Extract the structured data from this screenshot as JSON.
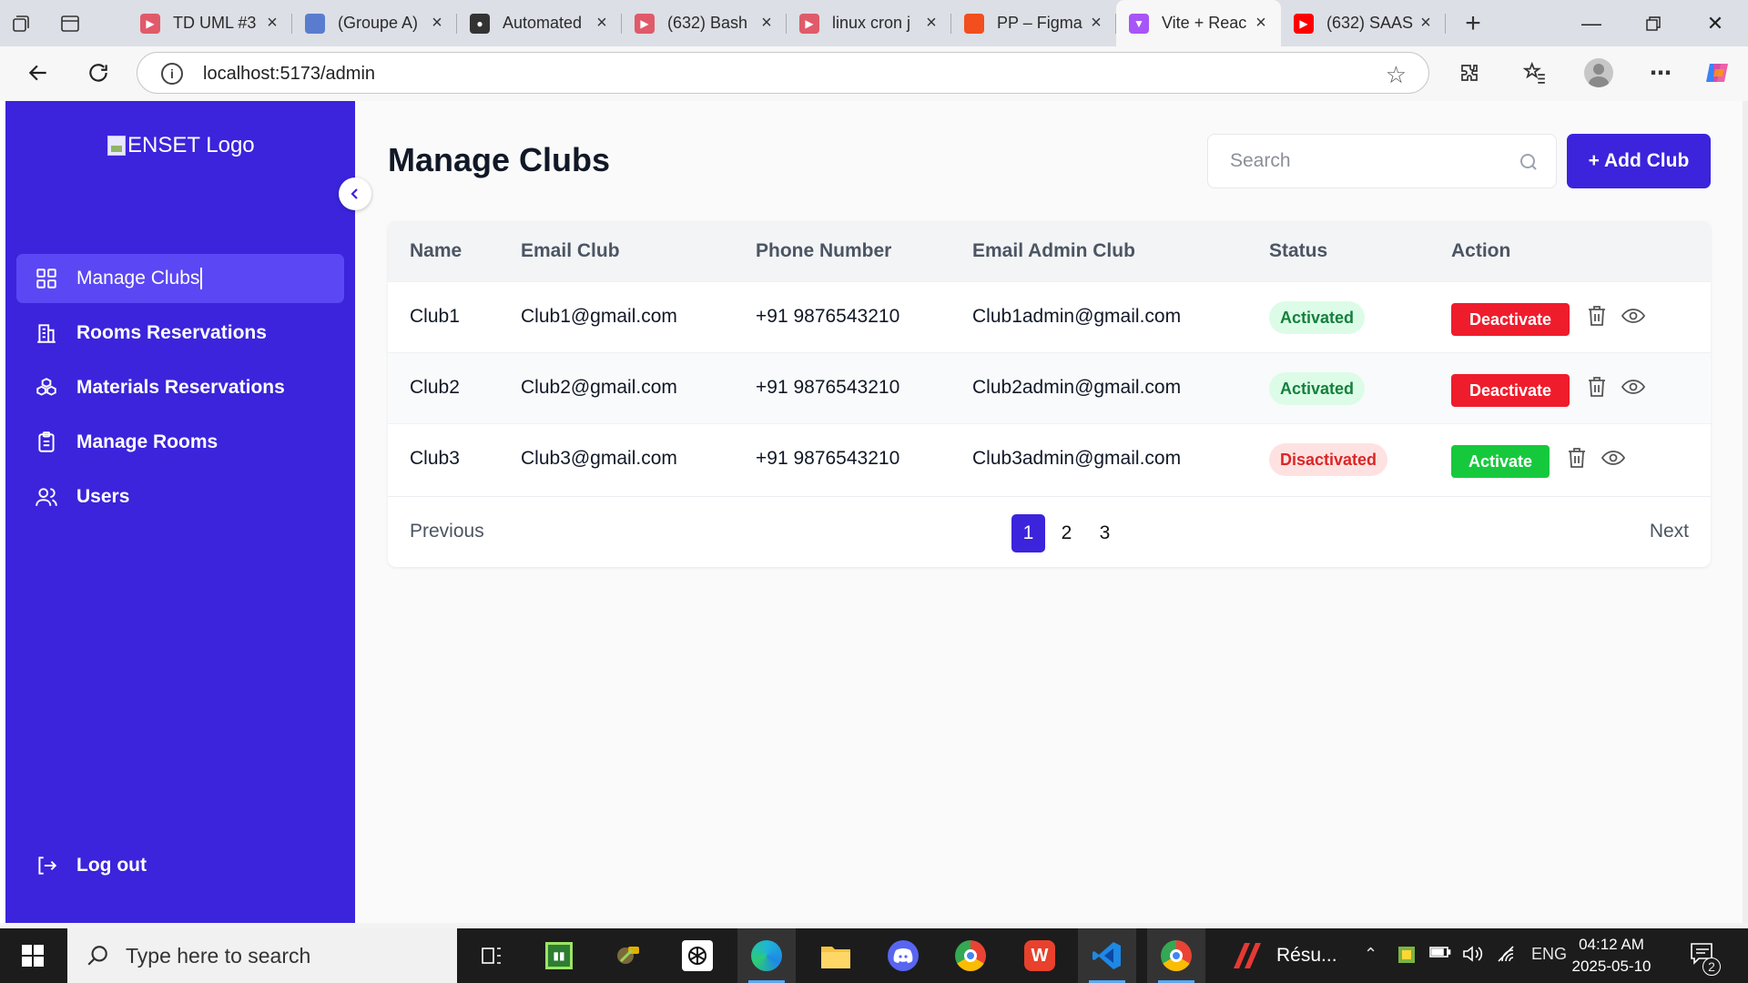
{
  "browser": {
    "tabs": [
      {
        "title": "TD UML #3",
        "favicon": "youtube-icon",
        "color": "#e05a6a"
      },
      {
        "title": "(Groupe A)",
        "favicon": "contacts-icon",
        "color": "#5a7ccf"
      },
      {
        "title": "Automated",
        "favicon": "github-icon",
        "color": "#333333"
      },
      {
        "title": "(632) Bash",
        "favicon": "youtube-icon",
        "color": "#e05a6a"
      },
      {
        "title": "linux cron j",
        "favicon": "youtube-icon",
        "color": "#e05a6a"
      },
      {
        "title": "PP – Figma",
        "favicon": "figma-icon",
        "color": "#f24e1e"
      },
      {
        "title": "Vite + Reac",
        "favicon": "vite-icon",
        "color": "#a855f7",
        "active": true
      },
      {
        "title": "(632) SAAS",
        "favicon": "youtube-icon",
        "color": "#ff0000"
      }
    ],
    "url": "localhost:5173/admin"
  },
  "sidebar": {
    "logo_alt": "ENSET Logo",
    "items": [
      {
        "label": "Manage Clubs",
        "icon": "grid-icon",
        "active": true
      },
      {
        "label": "Rooms Reservations",
        "icon": "building-icon"
      },
      {
        "label": "Materials Reservations",
        "icon": "boxes-icon"
      },
      {
        "label": "Manage Rooms",
        "icon": "clipboard-icon"
      },
      {
        "label": "Users",
        "icon": "users-icon"
      }
    ],
    "logout_label": "Log out"
  },
  "main": {
    "title": "Manage Clubs",
    "search_placeholder": "Search",
    "add_button": "+ Add Club",
    "columns": [
      "Name",
      "Email Club",
      "Phone Number",
      "Email Admin Club",
      "Status",
      "Action"
    ],
    "rows": [
      {
        "name": "Club1",
        "email": "Club1@gmail.com",
        "phone": "+91 9876543210",
        "admin_email": "Club1admin@gmail.com",
        "status": "Activated",
        "action": "Deactivate"
      },
      {
        "name": "Club2",
        "email": "Club2@gmail.com",
        "phone": "+91 9876543210",
        "admin_email": "Club2admin@gmail.com",
        "status": "Activated",
        "action": "Deactivate"
      },
      {
        "name": "Club3",
        "email": "Club3@gmail.com",
        "phone": "+91 9876543210",
        "admin_email": "Club3admin@gmail.com",
        "status": "Disactivated",
        "action": "Activate"
      }
    ],
    "pagination": {
      "previous": "Previous",
      "next": "Next",
      "pages": [
        "1",
        "2",
        "3"
      ],
      "current": "1"
    }
  },
  "taskbar": {
    "search_placeholder": "Type here to search",
    "app_label": "Résu...",
    "language": "ENG",
    "time": "04:12 AM",
    "date": "2025-05-10",
    "notification_count": "2"
  },
  "colors": {
    "primary": "#3b24db",
    "danger": "#ef1c2c",
    "success": "#16c93c"
  }
}
